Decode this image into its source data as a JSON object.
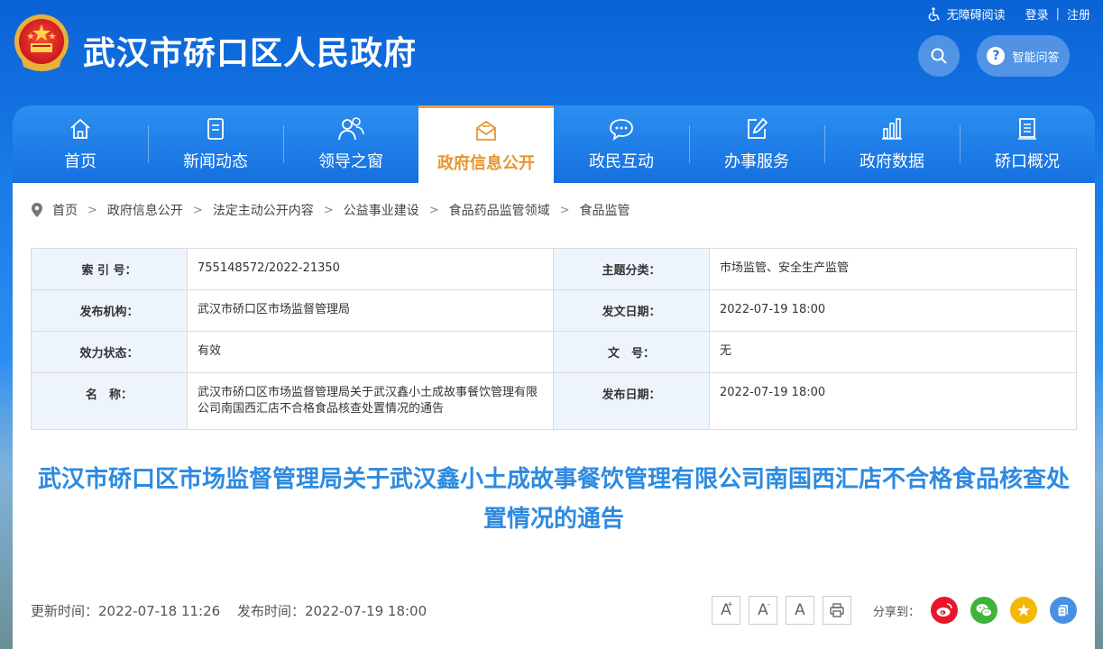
{
  "header": {
    "site_title": "武汉市硚口区人民政府",
    "accessibility_label": "无障碍阅读",
    "login_label": "登录",
    "register_label": "注册",
    "separator": "|",
    "qa_label": "智能问答",
    "qa_icon_glyph": "?"
  },
  "nav": {
    "items": [
      {
        "label": "首页",
        "icon": "home-icon"
      },
      {
        "label": "新闻动态",
        "icon": "document-icon"
      },
      {
        "label": "领导之窗",
        "icon": "people-icon"
      },
      {
        "label": "政府信息公开",
        "icon": "mail-icon"
      },
      {
        "label": "政民互动",
        "icon": "chat-icon"
      },
      {
        "label": "办事服务",
        "icon": "edit-icon"
      },
      {
        "label": "政府数据",
        "icon": "bar-chart-icon"
      },
      {
        "label": "硚口概况",
        "icon": "list-icon"
      }
    ],
    "active_index": 3
  },
  "breadcrumb": {
    "items": [
      "首页",
      "政府信息公开",
      "法定主动公开内容",
      "公益事业建设",
      "食品药品监管领域",
      "食品监管"
    ],
    "separator": ">"
  },
  "meta_table": {
    "index_label": "索 引 号：",
    "index_value": "755148572/2022-21350",
    "category_label": "主题分类：",
    "category_value": "市场监管、安全生产监管",
    "agency_label": "发布机构：",
    "agency_value": "武汉市硚口区市场监督管理局",
    "doc_date_label": "发文日期：",
    "doc_date_value": "2022-07-19 18:00",
    "status_label": "效力状态：",
    "status_value": "有效",
    "doc_no_label": "文　号：",
    "doc_no_value": "无",
    "name_label": "名　称：",
    "name_value": "武汉市硚口区市场监督管理局关于武汉鑫小土成故事餐饮管理有限公司南国西汇店不合格食品核查处置情况的通告",
    "publish_date_label": "发布日期：",
    "publish_date_value": "2022-07-19 18:00"
  },
  "article": {
    "title": "武汉市硚口区市场监督管理局关于武汉鑫小土成故事餐饮管理有限公司南国西汇店不合格食品核查处置情况的通告",
    "updated": "更新时间：2022-07-18 11:26",
    "published": "发布时间：2022-07-19 18:00"
  },
  "tools": {
    "font_large": "A",
    "font_large_mark": "+",
    "font_small": "A",
    "font_small_mark": "-",
    "font_reset": "A"
  },
  "share": {
    "label": "分享到：",
    "icons": [
      "weibo-icon",
      "wechat-icon",
      "qzone-icon",
      "copy-link-icon"
    ]
  },
  "colors": {
    "brand_blue": "#1670e0",
    "active_orange": "#e8952a",
    "title_blue": "#2d8ae0",
    "weibo_red": "#e6162d",
    "wechat_green": "#3fb338",
    "qzone_yellow": "#f5b800",
    "link_blue": "#4a90e2"
  }
}
